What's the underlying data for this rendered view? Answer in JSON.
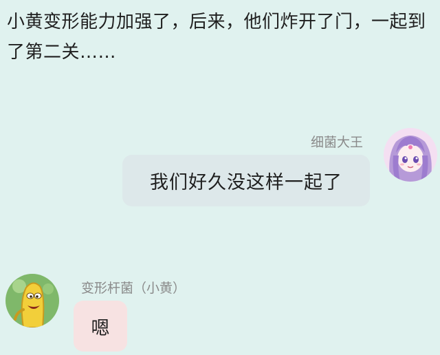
{
  "narration": {
    "text": "小黄变形能力加强了，后来，他们炸开了门，一起到了第二关……"
  },
  "messages": [
    {
      "sender": "细菌大王",
      "text": "我们好久没这样一起了",
      "side": "right",
      "bubble_color": "#dde8ea",
      "avatar": "bacteria-king-avatar"
    },
    {
      "sender": "变形杆菌（小黄）",
      "text": "嗯",
      "side": "left",
      "bubble_color": "#f7e2e2",
      "avatar": "xiaohuang-avatar"
    }
  ],
  "colors": {
    "background": "#e0f2ef",
    "name_text": "#8a8a8a",
    "body_text": "#1f1f1f"
  }
}
